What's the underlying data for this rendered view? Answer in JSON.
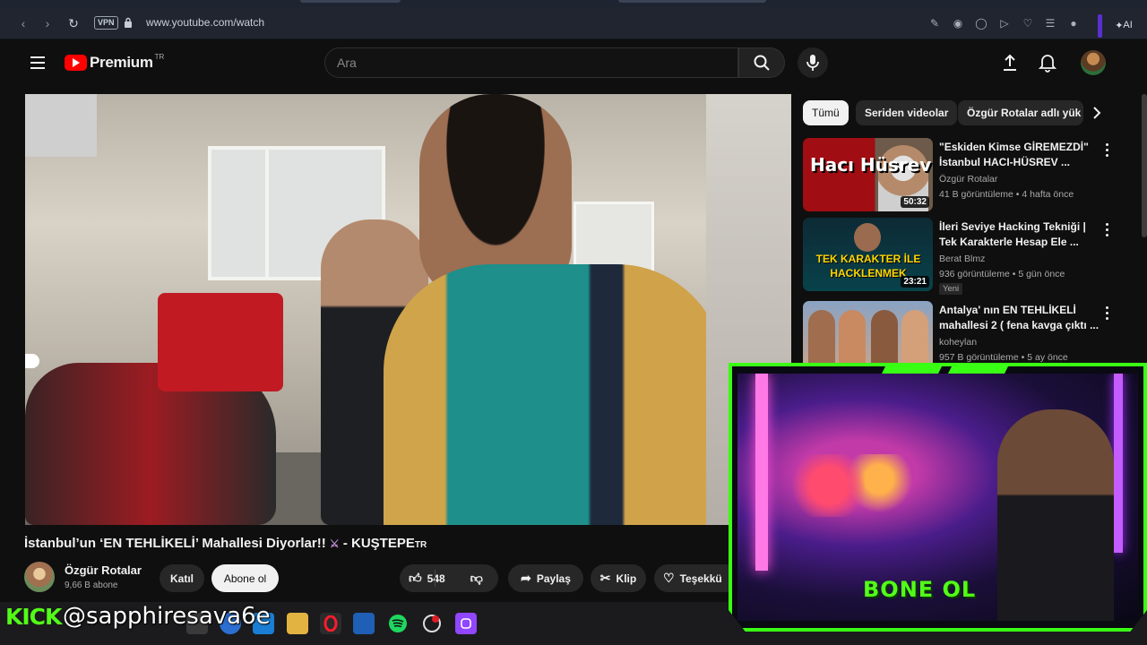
{
  "browser": {
    "url": "www.youtube.com/watch",
    "vpn_label": "VPN",
    "ai_label": "AI"
  },
  "masthead": {
    "logo_text": "Premium",
    "logo_country": "TR",
    "search_placeholder": "Ara"
  },
  "video": {
    "title": "İstanbul’un ‘EN TEHLİKELİ’ Mahallesi Diyorlar!!",
    "title_suffix": "- KUŞTEPE",
    "title_sup": "TR",
    "channel": "Özgür Rotalar",
    "subscribers": "9,66 B abone",
    "join_label": "Katıl",
    "subscribe_label": "Abone ol",
    "likes": "548",
    "share_label": "Paylaş",
    "clip_label": "Klip",
    "thanks_label": "Teşekkü"
  },
  "chips": [
    {
      "label": "Tümü"
    },
    {
      "label": "Seriden videolar"
    },
    {
      "label": "Özgür Rotalar adlı yük"
    }
  ],
  "recommendations": [
    {
      "title": "\"Eskiden Kimse GİREMEZDİ\" İstanbul HACI-HÜSREV ...",
      "channel": "Özgür Rotalar",
      "meta": "41 B görüntüleme • 4 hafta önce",
      "duration": "50:32",
      "thumb_text": "Hacı Hüsrev",
      "badge": ""
    },
    {
      "title": "İleri Seviye Hacking Tekniği | Tek Karakterle Hesap Ele ...",
      "channel": "Berat Blmz",
      "meta": "936 görüntüleme • 5 gün önce",
      "duration": "23:21",
      "thumb_text": "TEK KARAKTER İLE HACKLENMEK",
      "badge": "Yeni"
    },
    {
      "title": "Antalya' nın EN TEHLİKELİ mahallesi 2 ( fena kavga çıktı ...",
      "channel": "koheylan",
      "meta": "957 B görüntüleme • 5 ay önce",
      "duration": "",
      "thumb_text": "",
      "badge": ""
    }
  ],
  "overlay": {
    "kick_label": "KICK",
    "handle": "@sapphiresava6e",
    "cam_text": "BONE OL"
  },
  "colors": {
    "youtube_red": "#ff0000",
    "kick_green": "#53fc18",
    "background": "#0f0f0f"
  }
}
